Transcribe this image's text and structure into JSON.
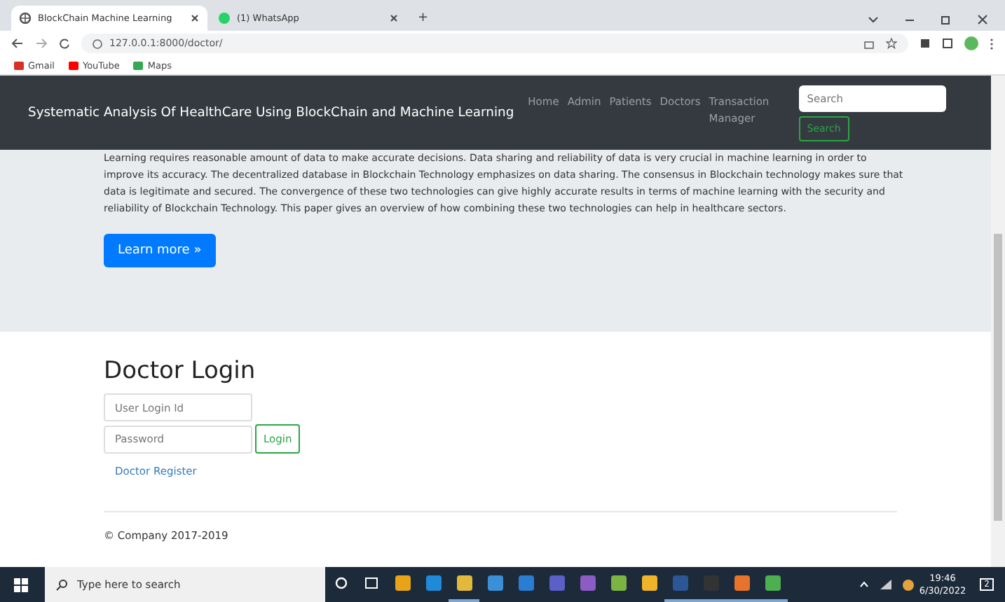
{
  "browser": {
    "tabs": [
      {
        "title": "BlockChain Machine Learning",
        "selected": true,
        "kind": "globe"
      },
      {
        "title": "(1) WhatsApp",
        "selected": false,
        "kind": "chat"
      }
    ],
    "new_tab": "+",
    "url": "127.0.0.1:8000/doctor/",
    "bookmarks": [
      {
        "label": "Gmail",
        "color": "#d93025"
      },
      {
        "label": "YouTube",
        "color": "#ff0000"
      },
      {
        "label": "Maps",
        "color": "#34a853"
      }
    ]
  },
  "navbar": {
    "brand": "Systematic Analysis Of HealthCare Using BlockChain and Machine Learning",
    "links": [
      "Home",
      "Admin",
      "Patients",
      "Doctors",
      "Transaction Manager"
    ],
    "search": {
      "placeholder": "Search",
      "button": "Search"
    }
  },
  "jumbotron": {
    "text": "Learning requires reasonable amount of data to make accurate decisions. Data sharing and reliability of data is very crucial in machine learning in order to improve its accuracy. The decentralized database in Blockchain Technology emphasizes on data sharing. The consensus in Blockchain technology makes sure that data is legitimate and secured. The convergence of these two technologies can give highly accurate results in terms of machine learning with the security and reliability of Blockchain Technology. This paper gives an overview of how combining these two technologies can help in healthcare sectors.",
    "button": "Learn more »"
  },
  "login": {
    "title": "Doctor Login",
    "user_placeholder": "User Login Id",
    "password_placeholder": "Password",
    "button": "Login",
    "register": "Doctor Register"
  },
  "footer": "© Company 2017-2019",
  "taskbar": {
    "search_placeholder": "Type here to search",
    "apps": [
      {
        "color": "#e8a317",
        "active": false
      },
      {
        "color": "#1f8ad9",
        "active": false
      },
      {
        "color": "#e2b93b",
        "active": true
      },
      {
        "color": "#3b8ed8",
        "active": false
      },
      {
        "color": "#2b7cd3",
        "active": false
      },
      {
        "color": "#5b5fc7",
        "active": false
      },
      {
        "color": "#8a5cc4",
        "active": false
      },
      {
        "color": "#7cb342",
        "active": false
      },
      {
        "color": "#f0b429",
        "active": false
      },
      {
        "color": "#2b5797",
        "active": true
      },
      {
        "color": "#333333",
        "active": true
      },
      {
        "color": "#e8732a",
        "active": true
      },
      {
        "color": "#4caf50",
        "active": true
      }
    ],
    "time": "19:46",
    "date": "6/30/2022",
    "notifications": "2"
  }
}
